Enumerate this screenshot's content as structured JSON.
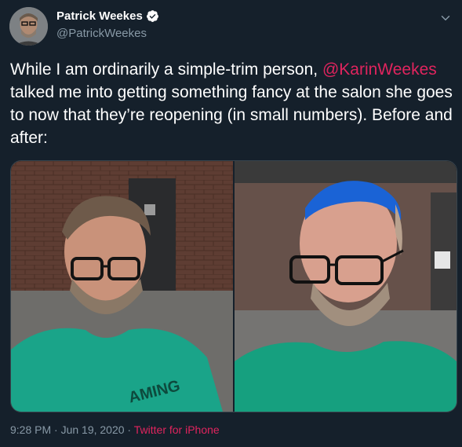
{
  "author": {
    "name": "Patrick Weekes",
    "handle": "@PatrickWeekes"
  },
  "tweet": {
    "text_before": "While I am ordinarily a simple-trim person, ",
    "mention": "@KarinWeekes",
    "text_after": " talked me into getting something fancy at the salon she goes to now that they’re reopening (in small numbers). Before and after:"
  },
  "photo_left": {
    "shirt_text": "AMING"
  },
  "meta": {
    "timestamp": "9:28 PM · Jun 19, 2020",
    "separator": " · ",
    "source": "Twitter for iPhone"
  },
  "colors": {
    "background": "#15202b",
    "accent": "#e0245e",
    "muted": "#8899a6",
    "verified": "#ffffff"
  },
  "icons": {
    "verified": "verified-badge-icon",
    "chevron": "chevron-down-icon"
  }
}
